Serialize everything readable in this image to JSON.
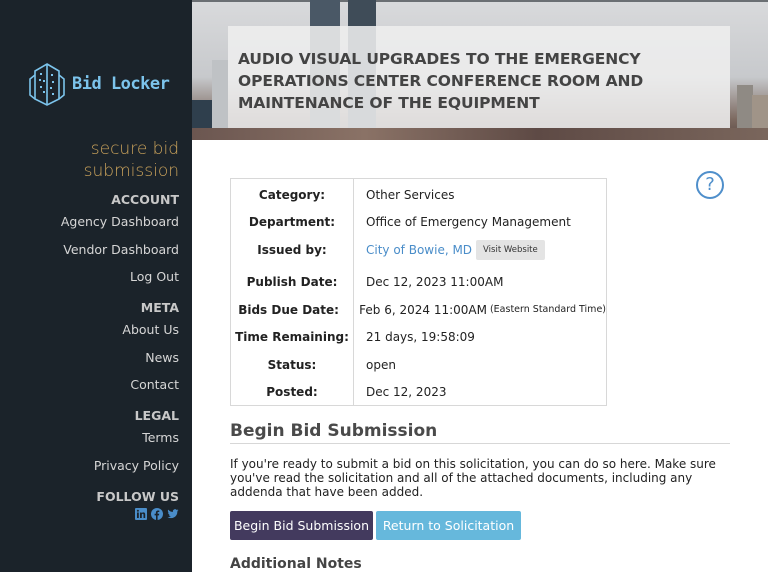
{
  "brand": {
    "name": "Bid Locker",
    "tagline": "secure bid submission",
    "logo_color": "#7cc4ec",
    "tagline_color": "#c9a25b"
  },
  "sidebar": {
    "groups": [
      {
        "heading": "ACCOUNT",
        "items": [
          {
            "label": "Agency Dashboard"
          },
          {
            "label": "Vendor Dashboard"
          },
          {
            "label": "Log Out"
          }
        ]
      },
      {
        "heading": "META",
        "items": [
          {
            "label": "About Us"
          },
          {
            "label": "News"
          },
          {
            "label": "Contact"
          }
        ]
      },
      {
        "heading": "LEGAL",
        "items": [
          {
            "label": "Terms"
          },
          {
            "label": "Privacy Policy"
          }
        ]
      }
    ],
    "follow": {
      "heading": "FOLLOW US",
      "icons": [
        "linkedin-icon",
        "facebook-icon",
        "twitter-icon"
      ]
    }
  },
  "header": {
    "title": "AUDIO VISUAL UPGRADES TO THE EMERGENCY OPERATIONS CENTER CONFERENCE ROOM AND MAINTENANCE OF THE EQUIPMENT"
  },
  "help": {
    "icon": "question-circle-icon",
    "glyph": "?"
  },
  "details": {
    "rows": [
      {
        "label": "Category:",
        "value": "Other Services"
      },
      {
        "label": "Department:",
        "value": "Office of Emergency Management"
      },
      {
        "label": "Issued by:",
        "value": "City of Bowie, MD",
        "button": "Visit Website"
      },
      {
        "label": "Publish Date:",
        "value": "Dec 12, 2023 11:00AM"
      },
      {
        "label": "Bids Due Date:",
        "value": "Feb 6, 2024 11:00AM",
        "note": "(Eastern Standard Time)"
      },
      {
        "label": "Time Remaining:",
        "value": "21 days, 19:58:09"
      },
      {
        "label": "Status:",
        "value": "open"
      },
      {
        "label": "Posted:",
        "value": "Dec 12, 2023"
      }
    ]
  },
  "submission": {
    "title": "Begin Bid Submission",
    "description": "If you're ready to submit a bid on this solicitation, you can do so here. Make sure you've read the solicitation and all of the attached documents, including any addenda that have been added.",
    "primary_button": "Begin Bid Submission",
    "secondary_button": "Return to Solicitation",
    "primary_color": "#433a5e",
    "secondary_color": "#66b8dc"
  },
  "notes": {
    "title": "Additional Notes"
  }
}
